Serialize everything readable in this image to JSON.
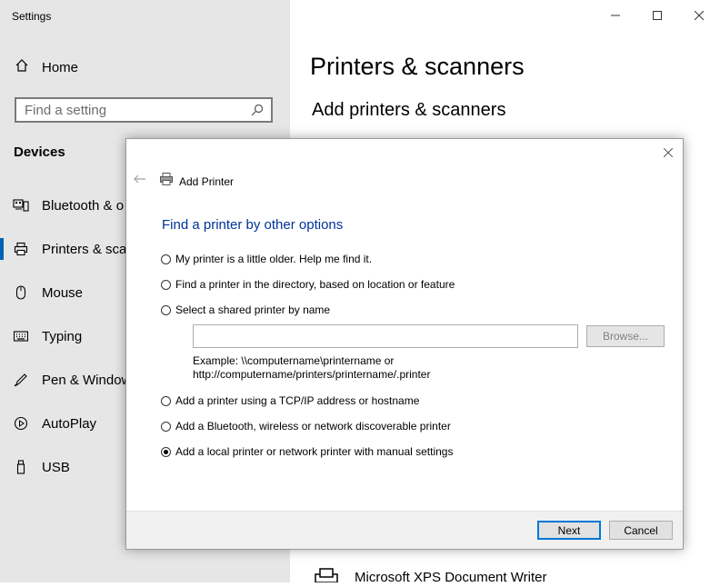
{
  "window": {
    "title": "Settings"
  },
  "sidebar": {
    "home_label": "Home",
    "search_placeholder": "Find a setting",
    "section_title": "Devices",
    "items": [
      {
        "label": "Bluetooth & o",
        "icon": "bluetooth-devices-icon"
      },
      {
        "label": "Printers & scan",
        "icon": "printer-icon",
        "active": true
      },
      {
        "label": "Mouse",
        "icon": "mouse-icon"
      },
      {
        "label": "Typing",
        "icon": "keyboard-icon"
      },
      {
        "label": "Pen & Window",
        "icon": "pen-icon"
      },
      {
        "label": "AutoPlay",
        "icon": "autoplay-icon"
      },
      {
        "label": "USB",
        "icon": "usb-icon"
      }
    ]
  },
  "main": {
    "title": "Printers & scanners",
    "subtitle": "Add printers & scanners",
    "printer_item": "Microsoft XPS Document Writer"
  },
  "dialog": {
    "title": "Add Printer",
    "heading": "Find a printer by other options",
    "options": [
      {
        "label": "My printer is a little older. Help me find it.",
        "selected": false
      },
      {
        "label": "Find a printer in the directory, based on location or feature",
        "selected": false
      },
      {
        "label": "Select a shared printer by name",
        "selected": false
      },
      {
        "label": "Add a printer using a TCP/IP address or hostname",
        "selected": false
      },
      {
        "label": "Add a Bluetooth, wireless or network discoverable printer",
        "selected": false
      },
      {
        "label": "Add a local printer or network printer with manual settings",
        "selected": true
      }
    ],
    "shared_printer_value": "",
    "browse_label": "Browse...",
    "example_line1": "Example: \\\\computername\\printername or",
    "example_line2": "http://computername/printers/printername/.printer",
    "next_label": "Next",
    "cancel_label": "Cancel"
  },
  "colors": {
    "accent": "#0063b1",
    "heading": "#003399",
    "sidebar_bg": "#e6e6e6"
  }
}
